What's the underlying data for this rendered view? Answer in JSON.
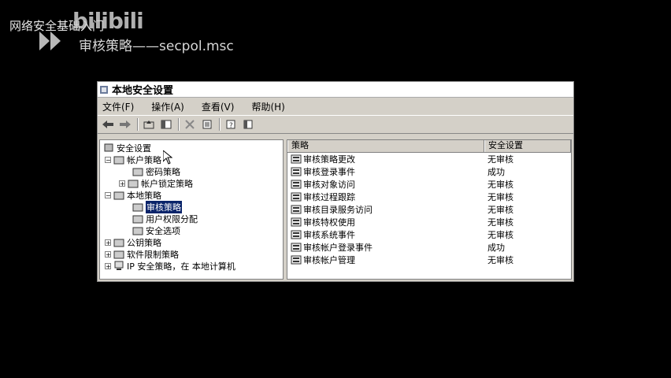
{
  "overlay": {
    "course_title": "网络安全基础入门",
    "watermark": "bilibili",
    "slide_title": "审核策略——secpol.msc"
  },
  "window": {
    "title": "本地安全设置",
    "menu": [
      "文件(F)",
      "操作(A)",
      "查看(V)",
      "帮助(H)"
    ],
    "toolbar_icons": [
      "back-icon",
      "forward-icon",
      "up-folder-icon",
      "show-tree-icon",
      "delete-icon",
      "properties-icon",
      "help-icon",
      "export-list-icon"
    ]
  },
  "tree": {
    "root": "安全设置",
    "account_policies": "帐户策略",
    "password_policy": "密码策略",
    "lockout_policy": "帐户锁定策略",
    "local_policies": "本地策略",
    "audit_policy": "审核策略",
    "user_rights": "用户权限分配",
    "security_options": "安全选项",
    "public_key": "公钥策略",
    "software_restriction": "软件限制策略",
    "ip_security": "IP 安全策略，在 本地计算机"
  },
  "list": {
    "col_policy": "策略",
    "col_setting": "安全设置",
    "rows": [
      {
        "policy": "审核策略更改",
        "setting": "无审核"
      },
      {
        "policy": "审核登录事件",
        "setting": "成功"
      },
      {
        "policy": "审核对象访问",
        "setting": "无审核"
      },
      {
        "policy": "审核过程跟踪",
        "setting": "无审核"
      },
      {
        "policy": "审核目录服务访问",
        "setting": "无审核"
      },
      {
        "policy": "审核特权使用",
        "setting": "无审核"
      },
      {
        "policy": "审核系统事件",
        "setting": "无审核"
      },
      {
        "policy": "审核帐户登录事件",
        "setting": "成功"
      },
      {
        "policy": "审核帐户管理",
        "setting": "无审核"
      }
    ]
  }
}
